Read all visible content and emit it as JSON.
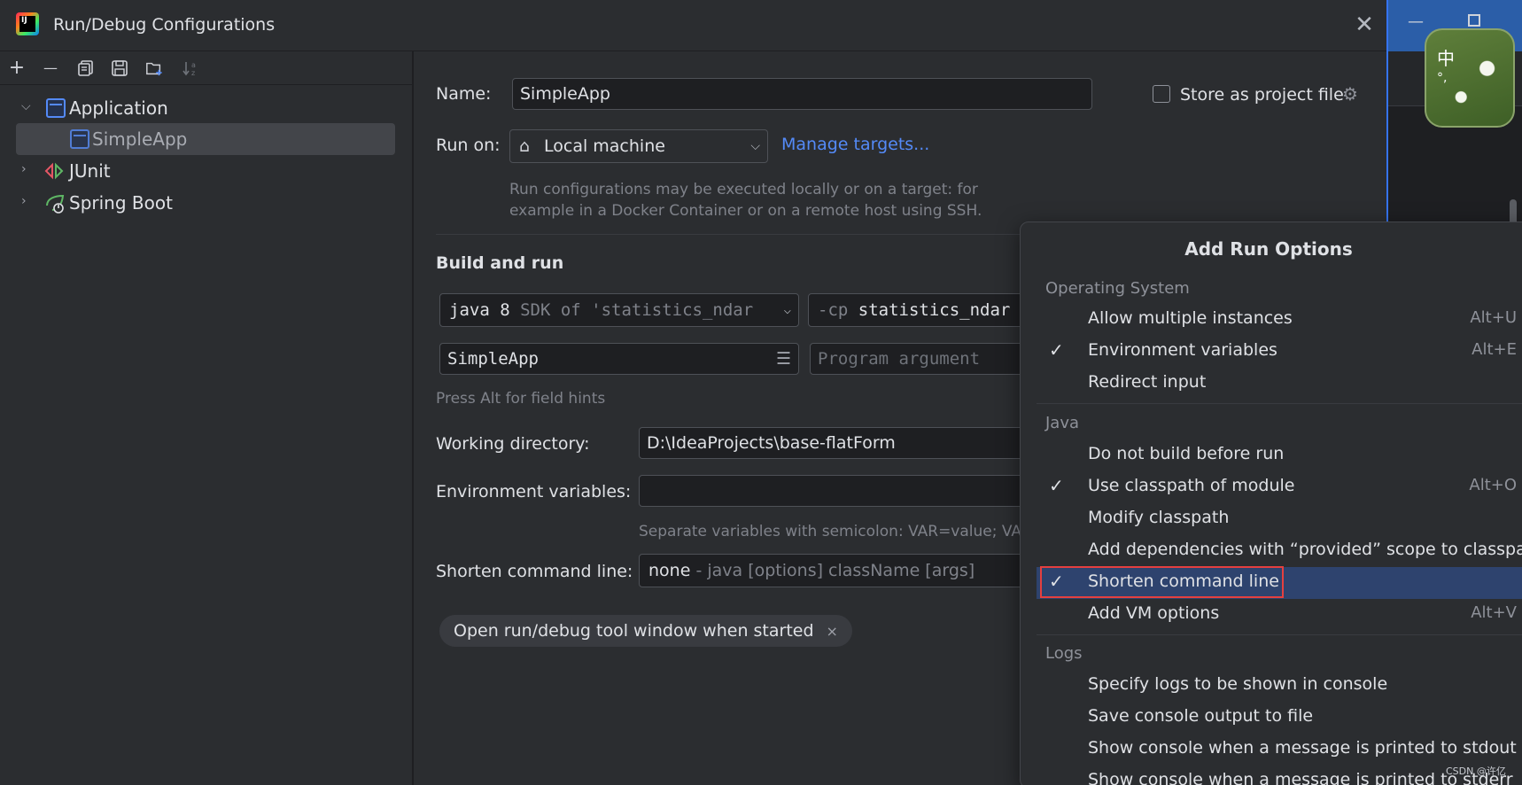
{
  "window": {
    "title": "Run/Debug Configurations",
    "close_glyph": "✕",
    "logo_text": "IJ"
  },
  "toolbar": {
    "add": "+",
    "remove": "—",
    "copy": "copy-icon",
    "save": "save-icon",
    "new_folder": "folder-add-icon",
    "sort": "sort-alpha-icon"
  },
  "tree": {
    "items": [
      {
        "label": "Application",
        "expanded": true,
        "icon": "application-icon"
      },
      {
        "label": "SimpleApp",
        "selected": true,
        "icon": "application-config-icon"
      },
      {
        "label": "JUnit",
        "expanded": false,
        "icon": "junit-icon"
      },
      {
        "label": "Spring Boot",
        "expanded": false,
        "icon": "spring-boot-icon"
      }
    ]
  },
  "form": {
    "name_label": "Name:",
    "name_value": "SimpleApp",
    "store_label": "Store as project file",
    "run_on_label": "Run on:",
    "run_on_value": "Local machine",
    "manage_targets": "Manage targets...",
    "run_on_hint_1": "Run configurations may be executed locally or on a target: for",
    "run_on_hint_2": "example in a Docker Container or on a remote host using SSH.",
    "build_run_title": "Build and run",
    "sdk_main": "java 8",
    "sdk_detail": "SDK of 'statistics_ndar",
    "cp_prefix": "-cp",
    "cp_value": "statistics_ndar",
    "main_class": "SimpleApp",
    "program_args_placeholder": "Program argument",
    "field_hints": "Press Alt for field hints",
    "working_dir_label": "Working directory:",
    "working_dir_value": "D:\\IdeaProjects\\base-flatForm",
    "env_label": "Environment variables:",
    "env_value": "",
    "env_hint": "Separate variables with semicolon: VAR=value; VA",
    "shorten_label": "Shorten command line:",
    "shorten_value": "none",
    "shorten_detail": "- java [options] className [args]",
    "chip_label": "Open run/debug tool window when started",
    "chip_close": "×"
  },
  "popup": {
    "title": "Add Run Options",
    "groups": [
      {
        "name": "Operating System"
      },
      {
        "name": "Java"
      },
      {
        "name": "Logs"
      }
    ],
    "items": [
      {
        "label": "Allow multiple instances",
        "checked": false,
        "shortcut": "Alt+U"
      },
      {
        "label": "Environment variables",
        "checked": true,
        "shortcut": "Alt+E"
      },
      {
        "label": "Redirect input",
        "checked": false,
        "shortcut": ""
      },
      {
        "label": "Do not build before run",
        "checked": false,
        "shortcut": ""
      },
      {
        "label": "Use classpath of module",
        "checked": true,
        "shortcut": "Alt+O"
      },
      {
        "label": "Modify classpath",
        "checked": false,
        "shortcut": ""
      },
      {
        "label": "Add dependencies with “provided” scope to classpath",
        "checked": false,
        "shortcut": ""
      },
      {
        "label": "Shorten command line",
        "checked": true,
        "shortcut": "",
        "highlighted": true
      },
      {
        "label": "Add VM options",
        "checked": false,
        "shortcut": "Alt+V"
      },
      {
        "label": "Specify logs to be shown in console",
        "checked": false,
        "shortcut": ""
      },
      {
        "label": "Save console output to file",
        "checked": false,
        "shortcut": ""
      },
      {
        "label": "Show console when a message is printed to stdout",
        "checked": false,
        "shortcut": ""
      },
      {
        "label": "Show console when a message is printed to stderr",
        "checked": false,
        "shortcut": ""
      }
    ],
    "check_glyph": "✓"
  },
  "ime": {
    "char1": "中",
    "char2": "°,"
  },
  "watermark": "CSDN @许亿",
  "colors": {
    "accent": "#548af7",
    "selection": "#2e436e",
    "highlight_border": "#e5403f"
  }
}
